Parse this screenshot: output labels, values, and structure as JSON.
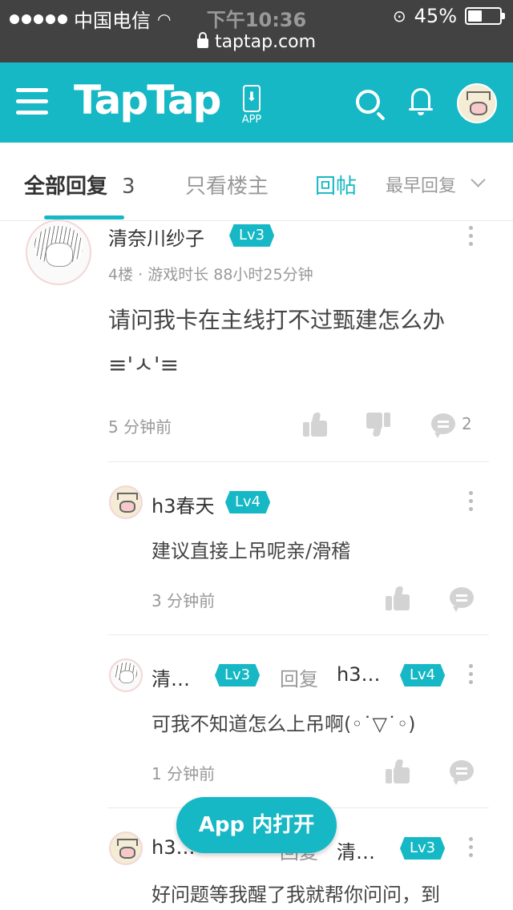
{
  "status_bar": {
    "carrier": "中国电信",
    "time": "下午10:36",
    "battery": "45%",
    "url": "taptap.com"
  },
  "nav": {
    "logo": "TapTap",
    "app_label": "APP"
  },
  "tabs": {
    "all": "全部回复",
    "all_count": "3",
    "host_only": "只看楼主",
    "reply": "回帖",
    "sort": "最早回复"
  },
  "comment": {
    "author": "清奈川纱子",
    "level": "Lv3",
    "meta": "4楼 · 游戏时长 88小时25分钟",
    "text": "请问我卡在主线打不过甄建怎么办≡'ㅅ'≡",
    "time": "5 分钟前",
    "reply_count": "2"
  },
  "replies": [
    {
      "author": "h3春天",
      "level": "Lv4",
      "text": "建议直接上吊呢亲/滑稽",
      "time": "3 分钟前"
    },
    {
      "author": "清…",
      "level": "Lv3",
      "reply_word": "回复",
      "target": "h3…",
      "target_level": "Lv4",
      "text": "可我不知道怎么上吊啊(◦˙▽˙◦)",
      "time": "1 分钟前"
    },
    {
      "author": "h3…",
      "reply_word": "回复",
      "target": "清…",
      "target_level": "Lv3",
      "text": "好问题等我醒了我就帮你问问，到"
    }
  ],
  "fab": "App 内打开"
}
